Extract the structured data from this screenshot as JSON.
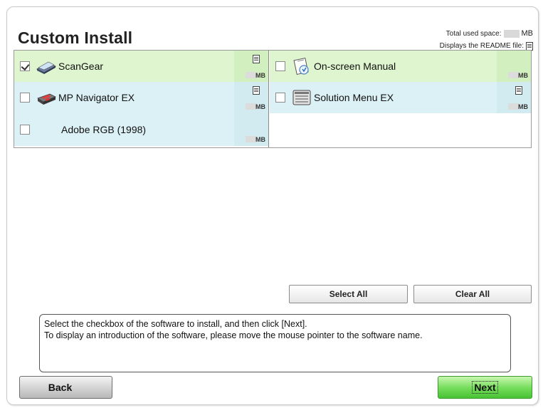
{
  "title": "Custom Install",
  "space_info": {
    "total_label": "Total used space:",
    "total_unit": "MB",
    "readme_label": "Displays the README file:"
  },
  "software": {
    "left": [
      {
        "name": "ScanGear",
        "checked": true,
        "has_readme": true,
        "unit": "MB",
        "icon": "scanner-icon"
      },
      {
        "name": "MP Navigator EX",
        "checked": false,
        "has_readme": true,
        "unit": "MB",
        "icon": "printer-icon"
      },
      {
        "name": "Adobe RGB (1998)",
        "checked": false,
        "has_readme": false,
        "unit": "MB",
        "icon": ""
      }
    ],
    "right": [
      {
        "name": "On-screen Manual",
        "checked": false,
        "has_readme": false,
        "unit": "MB",
        "icon": "manual-icon"
      },
      {
        "name": "Solution Menu EX",
        "checked": false,
        "has_readme": true,
        "unit": "MB",
        "icon": "solution-menu-icon"
      }
    ]
  },
  "buttons": {
    "select_all": "Select All",
    "clear_all": "Clear All",
    "back": "Back",
    "next": "Next"
  },
  "description": {
    "line1": "Select the checkbox of the software to install, and then click [Next].",
    "line2": "To display an introduction of the software, please move the mouse pointer to the software name."
  },
  "colors": {
    "row_green": "#dff5cf",
    "row_blue": "#dcf1f5",
    "next_button": "#72dc58"
  }
}
